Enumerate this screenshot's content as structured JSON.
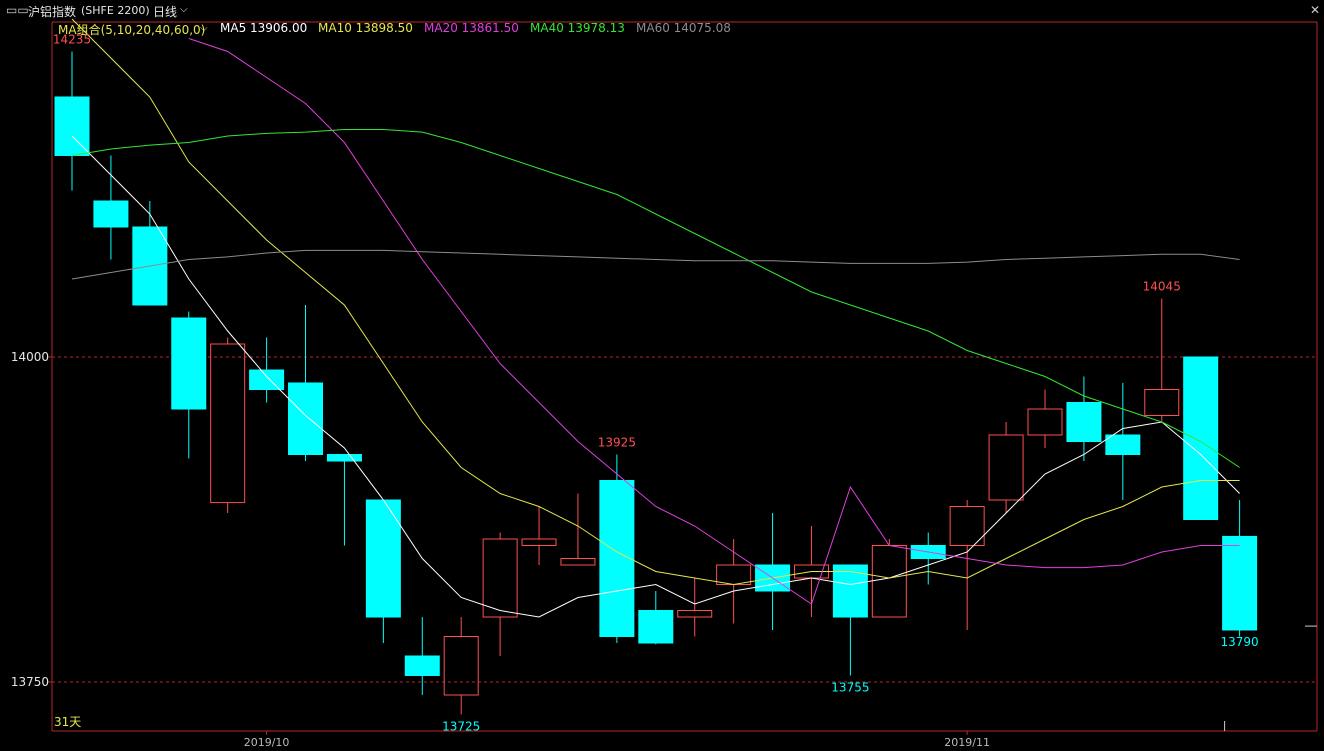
{
  "header": {
    "window_icon": "window-toggle-icon",
    "title": "沪铝指数",
    "code": "(SHFE 2200)",
    "period": "日线",
    "period_icon": "chevron-down-icon",
    "close_icon": "close-icon"
  },
  "ma_legend": {
    "group_label": "MA组合(5,10,20,40,60,0)",
    "group_icon": "chevron-down-icon",
    "items": [
      {
        "label": "MA5 13906.00",
        "color": "#ffffff"
      },
      {
        "label": "MA10 13898.50",
        "color": "#e6e64c"
      },
      {
        "label": "MA20 13861.50",
        "color": "#e040e0"
      },
      {
        "label": "MA40 13978.13",
        "color": "#33e633"
      },
      {
        "label": "MA60 14075.08",
        "color": "#8c8c8c"
      }
    ]
  },
  "colors": {
    "up": "#ff5050",
    "down": "#00ffff",
    "axis": "#b42828",
    "grid": "#b42828",
    "bg": "#000000"
  },
  "chart_data": {
    "type": "candlestick",
    "y_ticks": [
      "14000",
      "13750"
    ],
    "ylim": [
      13720,
      14270
    ],
    "x_labels": [
      {
        "index": 5,
        "label": "2019/10"
      },
      {
        "index": 23,
        "label": "2019/11"
      }
    ],
    "visible_bars": "31天",
    "annotations": [
      {
        "index": 0,
        "value": 14235,
        "text": "14235",
        "kind": "high"
      },
      {
        "index": 10,
        "value": 13725,
        "text": "13725",
        "kind": "low"
      },
      {
        "index": 14,
        "value": 13925,
        "text": "13925",
        "kind": "high"
      },
      {
        "index": 20,
        "value": 13755,
        "text": "13755",
        "kind": "low"
      },
      {
        "index": 28,
        "value": 14045,
        "text": "14045",
        "kind": "high"
      },
      {
        "index": 30,
        "value": 13790,
        "text": "13790",
        "kind": "low"
      }
    ],
    "last_price": 13793,
    "candles": [
      {
        "o": 14200,
        "h": 14235,
        "l": 14128,
        "c": 14155
      },
      {
        "o": 14120,
        "h": 14155,
        "l": 14075,
        "c": 14100
      },
      {
        "o": 14100,
        "h": 14120,
        "l": 14040,
        "c": 14040
      },
      {
        "o": 14030,
        "h": 14035,
        "l": 13922,
        "c": 13960
      },
      {
        "o": 13888,
        "h": 14015,
        "l": 13880,
        "c": 14010
      },
      {
        "o": 13990,
        "h": 14015,
        "l": 13965,
        "c": 13975
      },
      {
        "o": 13980,
        "h": 14040,
        "l": 13920,
        "c": 13925
      },
      {
        "o": 13925,
        "h": 13910,
        "l": 13855,
        "c": 13920
      },
      {
        "o": 13890,
        "h": 13890,
        "l": 13780,
        "c": 13800
      },
      {
        "o": 13770,
        "h": 13800,
        "l": 13740,
        "c": 13755
      },
      {
        "o": 13740,
        "h": 13800,
        "l": 13725,
        "c": 13785
      },
      {
        "o": 13800,
        "h": 13865,
        "l": 13770,
        "c": 13860
      },
      {
        "o": 13855,
        "h": 13885,
        "l": 13840,
        "c": 13860
      },
      {
        "o": 13840,
        "h": 13895,
        "l": 13840,
        "c": 13845
      },
      {
        "o": 13905,
        "h": 13925,
        "l": 13780,
        "c": 13785
      },
      {
        "o": 13805,
        "h": 13820,
        "l": 13779,
        "c": 13780
      },
      {
        "o": 13800,
        "h": 13830,
        "l": 13785,
        "c": 13805
      },
      {
        "o": 13825,
        "h": 13860,
        "l": 13795,
        "c": 13840
      },
      {
        "o": 13840,
        "h": 13880,
        "l": 13790,
        "c": 13820
      },
      {
        "o": 13830,
        "h": 13870,
        "l": 13800,
        "c": 13840
      },
      {
        "o": 13840,
        "h": 13840,
        "l": 13755,
        "c": 13800
      },
      {
        "o": 13800,
        "h": 13860,
        "l": 13800,
        "c": 13855
      },
      {
        "o": 13855,
        "h": 13865,
        "l": 13825,
        "c": 13845
      },
      {
        "o": 13855,
        "h": 13890,
        "l": 13790,
        "c": 13885
      },
      {
        "o": 13890,
        "h": 13950,
        "l": 13880,
        "c": 13940
      },
      {
        "o": 13940,
        "h": 13975,
        "l": 13930,
        "c": 13960
      },
      {
        "o": 13965,
        "h": 13985,
        "l": 13920,
        "c": 13935
      },
      {
        "o": 13940,
        "h": 13980,
        "l": 13890,
        "c": 13925
      },
      {
        "o": 13955,
        "h": 14045,
        "l": 13950,
        "c": 13975
      },
      {
        "o": 14000,
        "h": 14000,
        "l": 13875,
        "c": 13875
      },
      {
        "o": 13862,
        "h": 13890,
        "l": 13785,
        "c": 13790
      }
    ],
    "series": [
      {
        "name": "MA5",
        "color": "#ffffff",
        "values": [
          14170,
          14140,
          14110,
          14060,
          14020,
          13985,
          13955,
          13930,
          13890,
          13845,
          13815,
          13805,
          13800,
          13815,
          13820,
          13825,
          13810,
          13820,
          13825,
          13830,
          13825,
          13830,
          13840,
          13850,
          13880,
          13910,
          13925,
          13945,
          13950,
          13925,
          13895
        ]
      },
      {
        "name": "MA10",
        "color": "#e6e64c",
        "values": [
          14260,
          14230,
          14200,
          14150,
          14120,
          14090,
          14065,
          14040,
          13995,
          13950,
          13915,
          13895,
          13885,
          13870,
          13850,
          13835,
          13830,
          13825,
          13830,
          13835,
          13835,
          13830,
          13835,
          13830,
          13845,
          13860,
          13875,
          13885,
          13900,
          13905,
          13905
        ]
      },
      {
        "name": "MA20",
        "color": "#e040e0",
        "values": [
          null,
          null,
          null,
          14245,
          14235,
          14215,
          14195,
          14165,
          14120,
          14075,
          14035,
          13995,
          13965,
          13935,
          13910,
          13885,
          13870,
          13850,
          13830,
          13810,
          13900,
          13855,
          13850,
          13845,
          13840,
          13838,
          13838,
          13840,
          13850,
          13855,
          13855
        ]
      },
      {
        "name": "MA40",
        "color": "#33e633",
        "values": [
          14155,
          14160,
          14163,
          14165,
          14170,
          14172,
          14173,
          14175,
          14175,
          14173,
          14165,
          14155,
          14145,
          14135,
          14125,
          14110,
          14095,
          14080,
          14065,
          14050,
          14040,
          14030,
          14020,
          14005,
          13995,
          13985,
          13970,
          13960,
          13950,
          13935,
          13915
        ]
      },
      {
        "name": "MA60",
        "color": "#8c8c8c",
        "values": [
          14060,
          14065,
          14070,
          14075,
          14077,
          14080,
          14082,
          14082,
          14082,
          14081,
          14080,
          14079,
          14078,
          14077,
          14076,
          14075,
          14074,
          14074,
          14074,
          14073,
          14072,
          14072,
          14072,
          14073,
          14075,
          14076,
          14077,
          14078,
          14079,
          14079,
          14075
        ]
      }
    ]
  }
}
